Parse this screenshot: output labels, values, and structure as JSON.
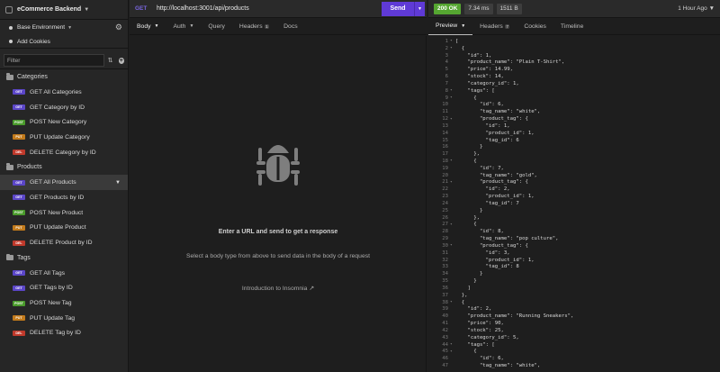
{
  "workspace": {
    "name": "eCommerce Backend"
  },
  "environment": {
    "label": "Base Environment"
  },
  "cookies": {
    "label": "Add Cookies"
  },
  "filter": {
    "placeholder": "Filter"
  },
  "sidebar": {
    "groups": [
      {
        "name": "Categories",
        "items": [
          {
            "method": "GET",
            "label": "GET All Categories"
          },
          {
            "method": "GET",
            "label": "GET Category by ID"
          },
          {
            "method": "POST",
            "label": "POST New Category"
          },
          {
            "method": "PUT",
            "label": "PUT Update Category"
          },
          {
            "method": "DEL",
            "label": "DELETE Category by ID"
          }
        ]
      },
      {
        "name": "Products",
        "items": [
          {
            "method": "GET",
            "label": "GET All Products",
            "active": true
          },
          {
            "method": "GET",
            "label": "GET Products by ID"
          },
          {
            "method": "POST",
            "label": "POST New Product"
          },
          {
            "method": "PUT",
            "label": "PUT Update Product"
          },
          {
            "method": "DEL",
            "label": "DELETE Product by ID"
          }
        ]
      },
      {
        "name": "Tags",
        "items": [
          {
            "method": "GET",
            "label": "GET All Tags"
          },
          {
            "method": "GET",
            "label": "GET Tags by ID"
          },
          {
            "method": "POST",
            "label": "POST New Tag"
          },
          {
            "method": "PUT",
            "label": "PUT Update Tag"
          },
          {
            "method": "DEL",
            "label": "DELETE Tag by ID"
          }
        ]
      }
    ]
  },
  "method_colors": {
    "GET": "#5b46c8",
    "POST": "#4a9b2c",
    "PUT": "#c27a1b",
    "DEL": "#c0392b"
  },
  "request": {
    "method": "GET",
    "url": "http://localhost:3001/api/products",
    "send_label": "Send",
    "tabs": [
      {
        "label": "Body",
        "dropdown": true,
        "selected": true
      },
      {
        "label": "Auth",
        "dropdown": true
      },
      {
        "label": "Query"
      },
      {
        "label": "Headers",
        "count": "1"
      },
      {
        "label": "Docs"
      }
    ],
    "empty_title": "Enter a URL and send to get a response",
    "empty_subtitle": "Select a body type from above to send data in the body of a request",
    "intro_link": "Introduction to Insomnia"
  },
  "response": {
    "status": "200 OK",
    "time": "7.34 ms",
    "size": "1511 B",
    "ago": "1 Hour Ago",
    "tabs": [
      {
        "label": "Preview",
        "dropdown": true,
        "selected": true
      },
      {
        "label": "Headers",
        "count": "7"
      },
      {
        "label": "Cookies"
      },
      {
        "label": "Timeline"
      }
    ],
    "code_lines": [
      "[",
      "  {",
      "    \"id\": 1,",
      "    \"product_name\": \"Plain T-Shirt\",",
      "    \"price\": 14.99,",
      "    \"stock\": 14,",
      "    \"category_id\": 1,",
      "    \"tags\": [",
      "      {",
      "        \"id\": 6,",
      "        \"tag_name\": \"white\",",
      "        \"product_tag\": {",
      "          \"id\": 1,",
      "          \"product_id\": 1,",
      "          \"tag_id\": 6",
      "        }",
      "      },",
      "      {",
      "        \"id\": 7,",
      "        \"tag_name\": \"gold\",",
      "        \"product_tag\": {",
      "          \"id\": 2,",
      "          \"product_id\": 1,",
      "          \"tag_id\": 7",
      "        }",
      "      },",
      "      {",
      "        \"id\": 8,",
      "        \"tag_name\": \"pop culture\",",
      "        \"product_tag\": {",
      "          \"id\": 3,",
      "          \"product_id\": 1,",
      "          \"tag_id\": 8",
      "        }",
      "      }",
      "    ]",
      "  },",
      "  {",
      "    \"id\": 2,",
      "    \"product_name\": \"Running Sneakers\",",
      "    \"price\": 90,",
      "    \"stock\": 25,",
      "    \"category_id\": 5,",
      "    \"tags\": [",
      "      {",
      "        \"id\": 6,",
      "        \"tag_name\": \"white\","
    ]
  }
}
